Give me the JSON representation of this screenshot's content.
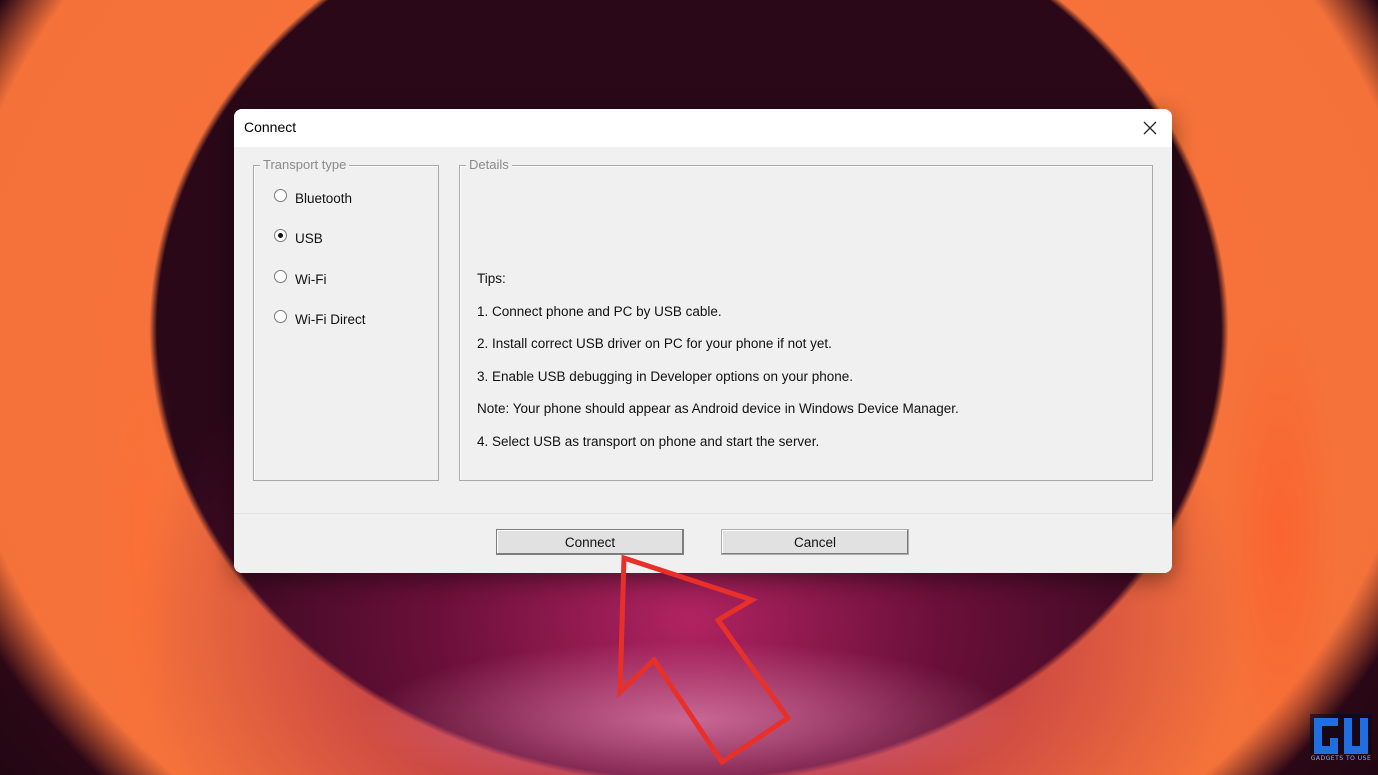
{
  "dialog": {
    "title": "Connect",
    "close_icon": "close-icon"
  },
  "transport": {
    "legend": "Transport type",
    "options": [
      {
        "label": "Bluetooth",
        "checked": false
      },
      {
        "label": "USB",
        "checked": true
      },
      {
        "label": "Wi-Fi",
        "checked": false
      },
      {
        "label": "Wi-Fi Direct",
        "checked": false
      }
    ]
  },
  "details": {
    "legend": "Details",
    "tips": [
      "Tips:",
      "1. Connect phone and PC by USB cable.",
      "2. Install correct USB driver on PC for your phone if not yet.",
      "3. Enable USB debugging in Developer options on your phone.",
      "Note: Your phone should appear as Android device in Windows Device Manager.",
      "4. Select USB as transport on phone and start the server."
    ]
  },
  "buttons": {
    "connect": "Connect",
    "cancel": "Cancel"
  },
  "watermark": {
    "tagline": "GADGETS TO USE",
    "icon": "gadgets-to-use-logo-icon"
  },
  "colors": {
    "arrow": "#e8302a",
    "dialog_bg": "#f0f0f0",
    "logo_blue": "#1f6fe0"
  }
}
